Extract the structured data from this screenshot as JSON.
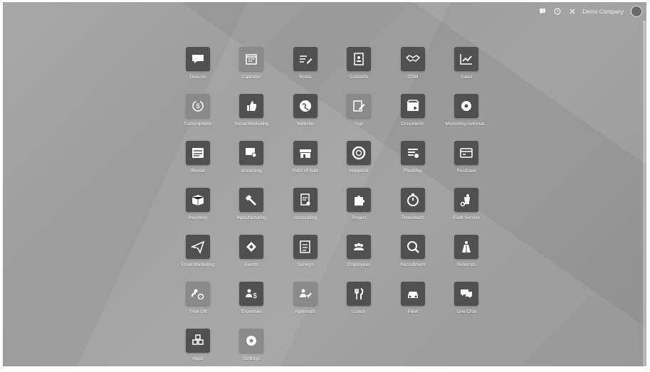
{
  "topbar": {
    "company": "Demo Company",
    "chat_icon": "chat-bubble-icon",
    "activity_icon": "clock-icon",
    "debug_icon": "bug-icon",
    "close_icon": "close-icon",
    "avatar_icon": "user-avatar-icon"
  },
  "apps": [
    {
      "label": "Discuss",
      "icon": "chat-icon"
    },
    {
      "label": "Calendar",
      "icon": "calendar-icon"
    },
    {
      "label": "Notes",
      "icon": "notes-icon"
    },
    {
      "label": "Contacts",
      "icon": "contacts-icon"
    },
    {
      "label": "CRM",
      "icon": "handshake-icon"
    },
    {
      "label": "Sales",
      "icon": "chart-up-icon"
    },
    {
      "label": "Subscriptions",
      "icon": "subscription-icon"
    },
    {
      "label": "Social Marketing",
      "icon": "thumbs-up-icon"
    },
    {
      "label": "Website",
      "icon": "globe-icon"
    },
    {
      "label": "Sign",
      "icon": "sign-icon"
    },
    {
      "label": "Documents",
      "icon": "documents-icon"
    },
    {
      "label": "Marketing Automat...",
      "icon": "gear-icon"
    },
    {
      "label": "Rental",
      "icon": "rental-icon"
    },
    {
      "label": "eLearning",
      "icon": "elearning-icon"
    },
    {
      "label": "Point of Sale",
      "icon": "store-icon"
    },
    {
      "label": "Helpdesk",
      "icon": "lifebuoy-icon"
    },
    {
      "label": "Planning",
      "icon": "planning-icon"
    },
    {
      "label": "Purchase",
      "icon": "credit-card-icon"
    },
    {
      "label": "Inventory",
      "icon": "box-icon"
    },
    {
      "label": "Manufacturing",
      "icon": "wrench-icon"
    },
    {
      "label": "Accounting",
      "icon": "accounting-icon"
    },
    {
      "label": "Project",
      "icon": "puzzle-icon"
    },
    {
      "label": "Timesheets",
      "icon": "stopwatch-icon"
    },
    {
      "label": "Field Service",
      "icon": "field-service-icon"
    },
    {
      "label": "Email Marketing",
      "icon": "paper-plane-icon"
    },
    {
      "label": "Events",
      "icon": "ticket-icon"
    },
    {
      "label": "Surveys",
      "icon": "survey-icon"
    },
    {
      "label": "Employees",
      "icon": "people-icon"
    },
    {
      "label": "Recruitment",
      "icon": "search-icon"
    },
    {
      "label": "Referrals",
      "icon": "referrals-icon"
    },
    {
      "label": "Time Off",
      "icon": "time-off-icon"
    },
    {
      "label": "Expenses",
      "icon": "expenses-icon"
    },
    {
      "label": "Approvals",
      "icon": "approvals-icon"
    },
    {
      "label": "Lunch",
      "icon": "utensils-icon"
    },
    {
      "label": "Fleet",
      "icon": "car-icon"
    },
    {
      "label": "Live Chat",
      "icon": "live-chat-icon"
    },
    {
      "label": "Apps",
      "icon": "cubes-icon"
    },
    {
      "label": "Settings",
      "icon": "settings-gear-icon"
    }
  ]
}
